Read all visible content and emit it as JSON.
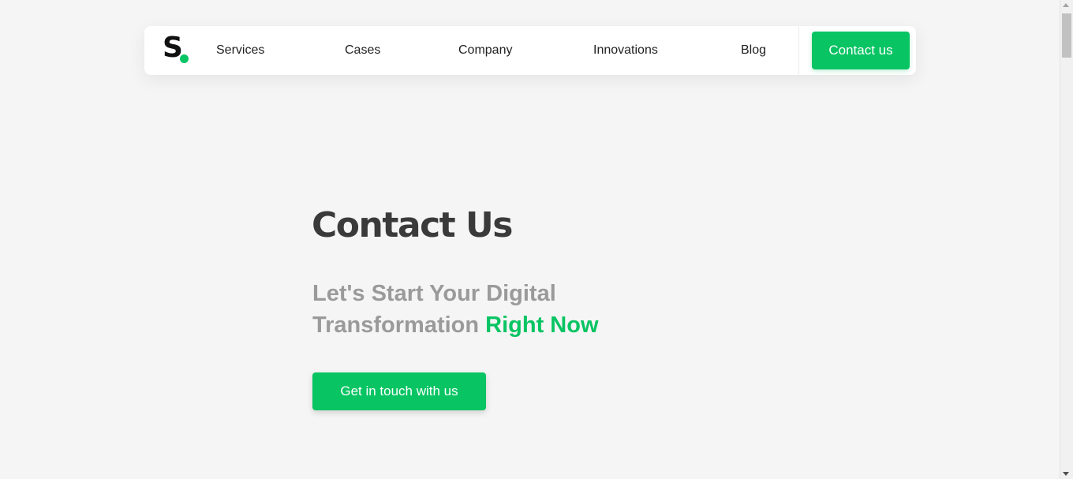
{
  "navbar": {
    "logo_letter": "S",
    "links": [
      {
        "label": "Services"
      },
      {
        "label": "Cases"
      },
      {
        "label": "Company"
      },
      {
        "label": "Innovations"
      },
      {
        "label": "Blog"
      }
    ],
    "cta_label": "Contact us"
  },
  "hero": {
    "title": "Contact Us",
    "subtitle_line1": "Let's Start Your Digital",
    "subtitle_line2": "Transformation",
    "subtitle_accent": "Right Now",
    "cta_label": "Get in touch with us"
  },
  "colors": {
    "accent": "#08c463",
    "background": "#f5f5f5",
    "title": "#3a3a3a",
    "subtitle": "#9a9a9a"
  },
  "icons": {
    "logo": "brand-s-logo",
    "scroll_up": "chevron-up-icon",
    "scroll_down": "chevron-down-icon"
  }
}
